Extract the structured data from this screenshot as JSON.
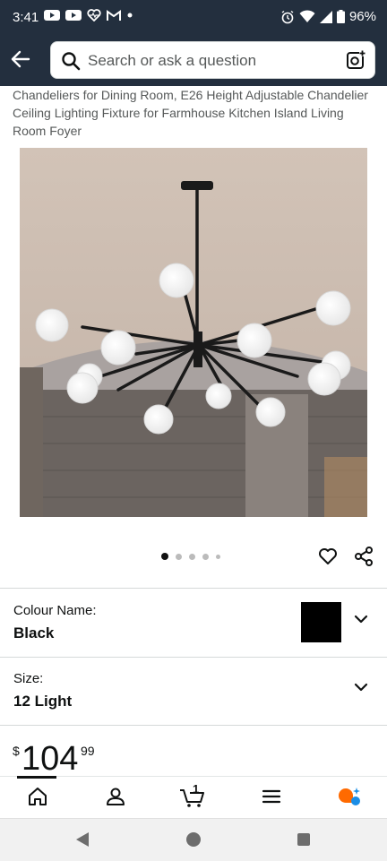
{
  "status_bar": {
    "time": "3:41",
    "battery": "96%",
    "left_icons": [
      "youtube-icon",
      "youtube-icon",
      "heart-monitor-icon",
      "gmail-icon",
      "dot-icon"
    ],
    "right_icons": [
      "alarm-icon",
      "wifi-icon",
      "signal-icon",
      "battery-icon"
    ]
  },
  "header": {
    "search_placeholder": "Search or ask a question",
    "icons": [
      "back-arrow-icon",
      "search-icon",
      "camera-scan-icon"
    ],
    "color": "#232f3e"
  },
  "product": {
    "title": "Chandeliers for Dining Room, E26 Height Adjustable Chandelier Ceiling Lighting Fixture for Farmhouse Kitchen Island Living Room Foyer",
    "image_description_icon": "chandelier-image",
    "carousel": {
      "total_dots": 5,
      "active_index": 0
    }
  },
  "options": {
    "colour_label": "Colour Name:",
    "colour_value": "Black",
    "swatch_color": "#000000",
    "size_label": "Size:",
    "size_value": "12 Light"
  },
  "price": {
    "symbol": "$",
    "whole": "104",
    "fraction": "99"
  },
  "tab_bar": {
    "cart_count": "1",
    "tabs": [
      "home-icon",
      "account-icon",
      "cart-icon",
      "menu-icon",
      "rufus-assistant-icon"
    ]
  },
  "system_nav": [
    "back-triangle-icon",
    "home-circle-icon",
    "recents-square-icon"
  ]
}
